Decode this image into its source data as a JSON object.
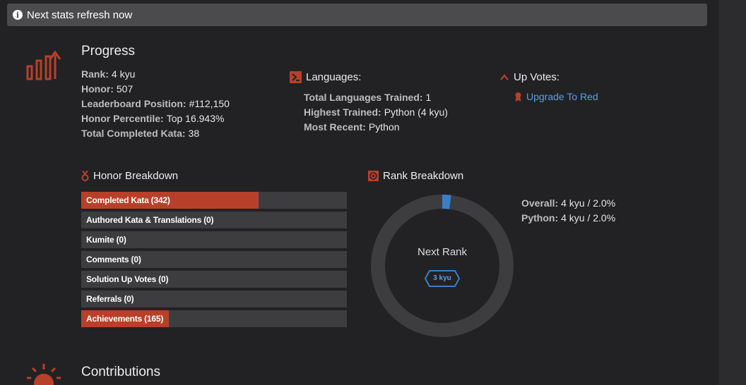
{
  "notice": {
    "text": "Next stats refresh now",
    "icon": "info-icon"
  },
  "progress": {
    "title": "Progress",
    "stats": [
      {
        "label": "Rank:",
        "value": "4 kyu"
      },
      {
        "label": "Honor:",
        "value": "507"
      },
      {
        "label": "Leaderboard Position:",
        "value": "#112,150"
      },
      {
        "label": "Honor Percentile:",
        "value": "Top 16.943%"
      },
      {
        "label": "Total Completed Kata:",
        "value": "38"
      }
    ]
  },
  "languages": {
    "title": "Languages:",
    "stats": [
      {
        "label": "Total Languages Trained:",
        "value": "1"
      },
      {
        "label": "Highest Trained:",
        "value": "Python (4 kyu)"
      },
      {
        "label": "Most Recent:",
        "value": "Python"
      }
    ]
  },
  "upvotes": {
    "title": "Up Votes:",
    "link": "Upgrade To Red"
  },
  "honor_breakdown": {
    "title": "Honor Breakdown",
    "bars": [
      {
        "label": "Completed Kata (342)",
        "fill": 0.667
      },
      {
        "label": "Authored Kata & Translations (0)",
        "fill": 0
      },
      {
        "label": "Kumite (0)",
        "fill": 0
      },
      {
        "label": "Comments (0)",
        "fill": 0
      },
      {
        "label": "Solution Up Votes (0)",
        "fill": 0
      },
      {
        "label": "Referrals (0)",
        "fill": 0
      },
      {
        "label": "Achievements (165)",
        "fill": 0.329
      }
    ]
  },
  "rank_breakdown": {
    "title": "Rank Breakdown",
    "center_label": "Next Rank",
    "next_rank": "3 kyu",
    "progress_fraction": 0.02,
    "stats": [
      {
        "label": "Overall:",
        "value": "4 kyu / 2.0%"
      },
      {
        "label": "Python:",
        "value": "4 kyu / 2.0%"
      }
    ]
  },
  "contributions": {
    "title": "Contributions"
  },
  "colors": {
    "accent_red": "#b8402a",
    "link_blue": "#5a9ee8",
    "bar_bg": "#3d3d40",
    "page_bg": "#222224"
  }
}
